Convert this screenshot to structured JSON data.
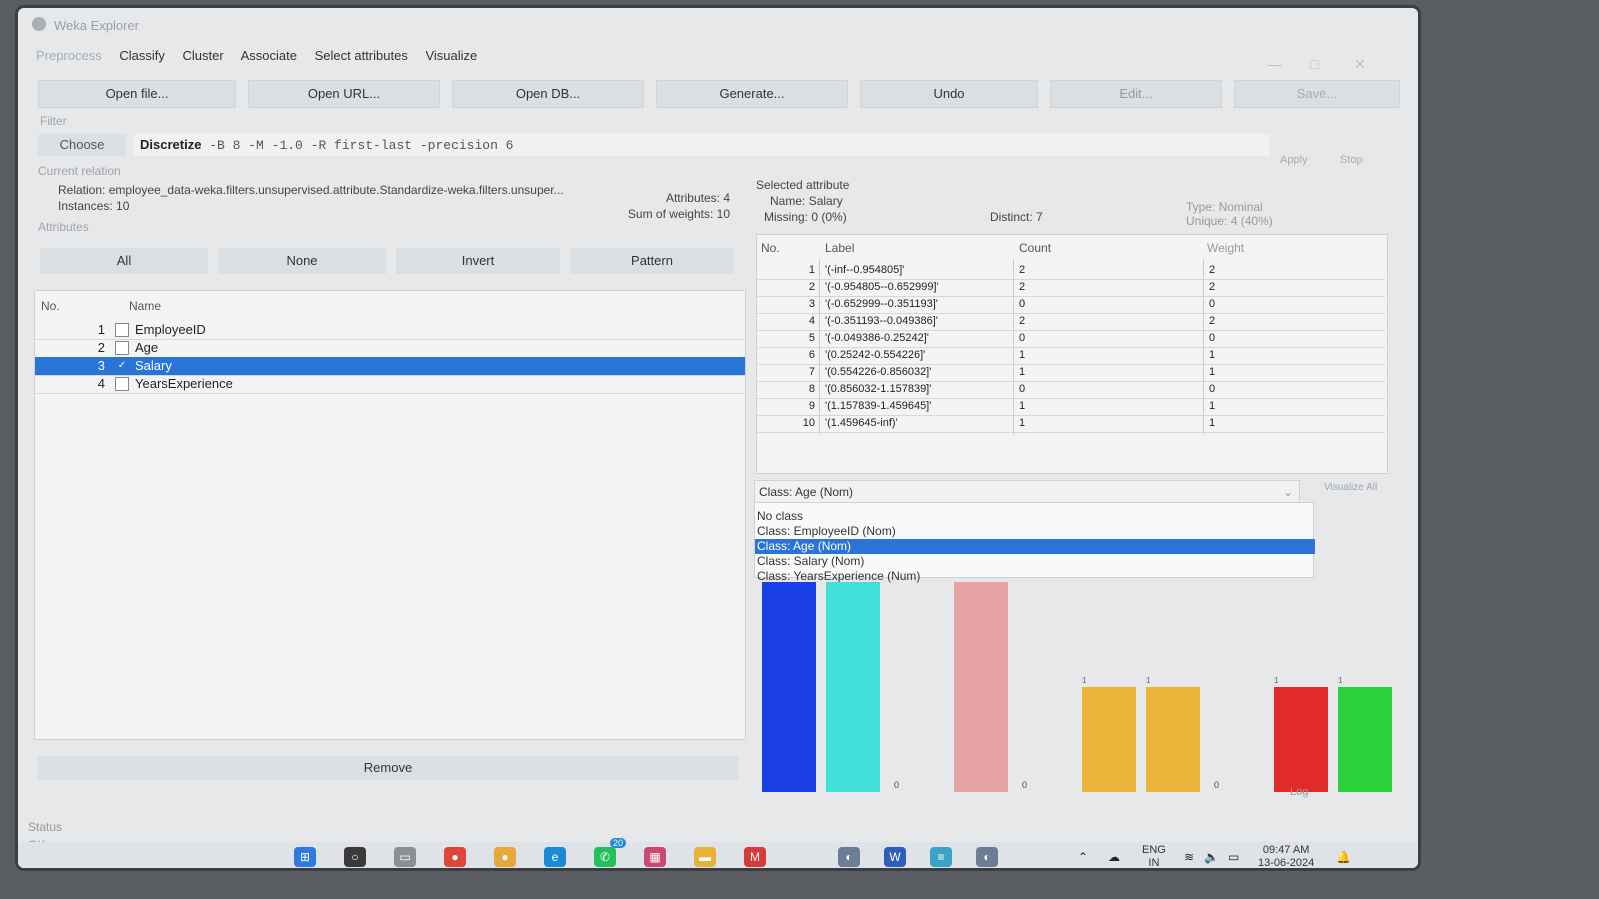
{
  "window": {
    "title": "Weka Explorer"
  },
  "menu": [
    "Preprocess",
    "Classify",
    "Cluster",
    "Associate",
    "Select attributes",
    "Visualize"
  ],
  "toolbar": [
    "Open file...",
    "Open URL...",
    "Open DB...",
    "Generate...",
    "Undo",
    "Edit...",
    "Save..."
  ],
  "filter": {
    "label": "Filter",
    "choose": "Choose",
    "name": "Discretize",
    "args": "-B 8 -M -1.0 -R first-last -precision 6",
    "apply": "Apply",
    "stop": "Stop"
  },
  "relation": {
    "section": "Current relation",
    "relation_label": "Relation:",
    "relation_value": "employee_data-weka.filters.unsupervised.attribute.Standardize-weka.filters.unsuper...",
    "instances_label": "Instances:",
    "instances_value": "10",
    "attributes_label": "Attributes:",
    "attributes_value": "4",
    "sow_label": "Sum of weights:",
    "sow_value": "10"
  },
  "attributes": {
    "section": "Attributes",
    "buttons": [
      "All",
      "None",
      "Invert",
      "Pattern"
    ],
    "col_no": "No.",
    "col_name": "Name",
    "rows": [
      {
        "no": "1",
        "name": "EmployeeID",
        "check": ""
      },
      {
        "no": "2",
        "name": "Age",
        "check": ""
      },
      {
        "no": "3",
        "name": "Salary",
        "check": "✓"
      },
      {
        "no": "4",
        "name": "YearsExperience",
        "check": ""
      }
    ],
    "remove": "Remove"
  },
  "selected": {
    "section": "Selected attribute",
    "name_label": "Name:",
    "name_value": "Salary",
    "missing_label": "Missing:",
    "missing_value": "0 (0%)",
    "distinct_label": "Distinct:",
    "distinct_value": "7",
    "type_label": "Type:",
    "type_value": "Nominal",
    "unique_label": "Unique:",
    "unique_value": "4 (40%)",
    "headers": [
      "No.",
      "Label",
      "Count",
      "Weight"
    ],
    "rows": [
      {
        "no": "1",
        "label": "'(-inf--0.954805]'",
        "count": "2",
        "weight": "2"
      },
      {
        "no": "2",
        "label": "'(-0.954805--0.652999]'",
        "count": "2",
        "weight": "2"
      },
      {
        "no": "3",
        "label": "'(-0.652999--0.351193]'",
        "count": "0",
        "weight": "0"
      },
      {
        "no": "4",
        "label": "'(-0.351193--0.049386]'",
        "count": "2",
        "weight": "2"
      },
      {
        "no": "5",
        "label": "'(-0.049386-0.25242]'",
        "count": "0",
        "weight": "0"
      },
      {
        "no": "6",
        "label": "'(0.25242-0.554226]'",
        "count": "1",
        "weight": "1"
      },
      {
        "no": "7",
        "label": "'(0.554226-0.856032]'",
        "count": "1",
        "weight": "1"
      },
      {
        "no": "8",
        "label": "'(0.856032-1.157839]'",
        "count": "0",
        "weight": "0"
      },
      {
        "no": "9",
        "label": "'(1.157839-1.459645]'",
        "count": "1",
        "weight": "1"
      },
      {
        "no": "10",
        "label": "'(1.459645-inf)'",
        "count": "1",
        "weight": "1"
      }
    ]
  },
  "classsel": {
    "current": "Class: Age (Nom)",
    "visualize_all": "Visualize All",
    "options": [
      "No class",
      "Class: EmployeeID (Nom)",
      "Class: Age (Nom)",
      "Class: Salary (Nom)",
      "Class: YearsExperience (Num)"
    ],
    "selected_index": 2
  },
  "histogram": {
    "bars": [
      {
        "count": 2,
        "color": "#1a3fe6"
      },
      {
        "count": 2,
        "color": "#3fe0d8"
      },
      {
        "count": 0,
        "color": ""
      },
      {
        "count": 2,
        "color": "#e6a3a3"
      },
      {
        "count": 0,
        "color": ""
      },
      {
        "count": 1,
        "color": "#eab33a"
      },
      {
        "count": 1,
        "color": "#eab33a"
      },
      {
        "count": 0,
        "color": ""
      },
      {
        "count": 1,
        "color": "#e12a2a"
      },
      {
        "count": 1,
        "color": "#2bd13a"
      }
    ],
    "log_label": "Log"
  },
  "status": {
    "label": "Status",
    "text": "OK"
  },
  "taskbar": {
    "lang1": "ENG",
    "lang2": "IN",
    "time": "09:47 AM",
    "date": "13-06-2024",
    "badge": "20"
  }
}
